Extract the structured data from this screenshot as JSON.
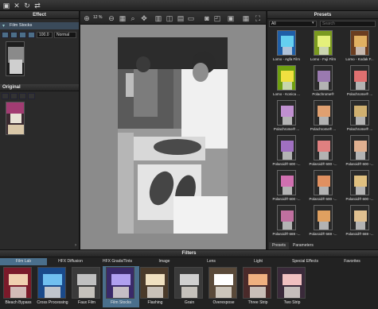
{
  "top_panel": {
    "effect_title": "Effect",
    "presets_title": "Presets"
  },
  "left_panel": {
    "category": "Film Stocks",
    "amount": "100.0",
    "blend_mode": "Normal",
    "original_title": "Original"
  },
  "toolbar": {
    "zoom": "12 %"
  },
  "presets": {
    "filter_select": "All",
    "search_placeholder": "Search",
    "items": [
      {
        "label": "Lomo - Agfa Film"
      },
      {
        "label": "Lomo - Fuji Film"
      },
      {
        "label": "Lomo - Kodak F..."
      },
      {
        "label": "Lomo - Konica ..."
      },
      {
        "label": "Polachrome®"
      },
      {
        "label": "Polachrome® ..."
      },
      {
        "label": "Polachrome® ..."
      },
      {
        "label": "Polachrome® ..."
      },
      {
        "label": "Polachrome® ..."
      },
      {
        "label": "Polaroid® 600 -..."
      },
      {
        "label": "Polaroid® 600 -..."
      },
      {
        "label": "Polaroid® 600 -..."
      },
      {
        "label": "Polaroid® 600 -..."
      },
      {
        "label": "Polaroid® 600 -..."
      },
      {
        "label": "Polaroid® 600 -..."
      },
      {
        "label": "Polaroid® 669 -..."
      },
      {
        "label": "Polaroid® 669 -..."
      },
      {
        "label": "Polaroid® 669 -..."
      }
    ],
    "tabs": [
      "Presets",
      "Parameters"
    ]
  },
  "filters": {
    "title": "Filters",
    "tabs": [
      "Film Lab",
      "HFX Diffusion",
      "HFX Grads/Tints",
      "Image",
      "Lens",
      "Light",
      "Special Effects",
      "Favorites"
    ],
    "items": [
      {
        "label": "Bleach Bypass"
      },
      {
        "label": "Cross Processing"
      },
      {
        "label": "Faux Film"
      },
      {
        "label": "Film Stocks"
      },
      {
        "label": "Flashing"
      },
      {
        "label": "Grain"
      },
      {
        "label": "Overexpose"
      },
      {
        "label": "Three Strip"
      },
      {
        "label": "Two Strip"
      }
    ]
  },
  "colors": {
    "selection_blue": "#4a6f8c",
    "panel_bg": "#262626",
    "canvas_bg": "#8b8b8b"
  }
}
